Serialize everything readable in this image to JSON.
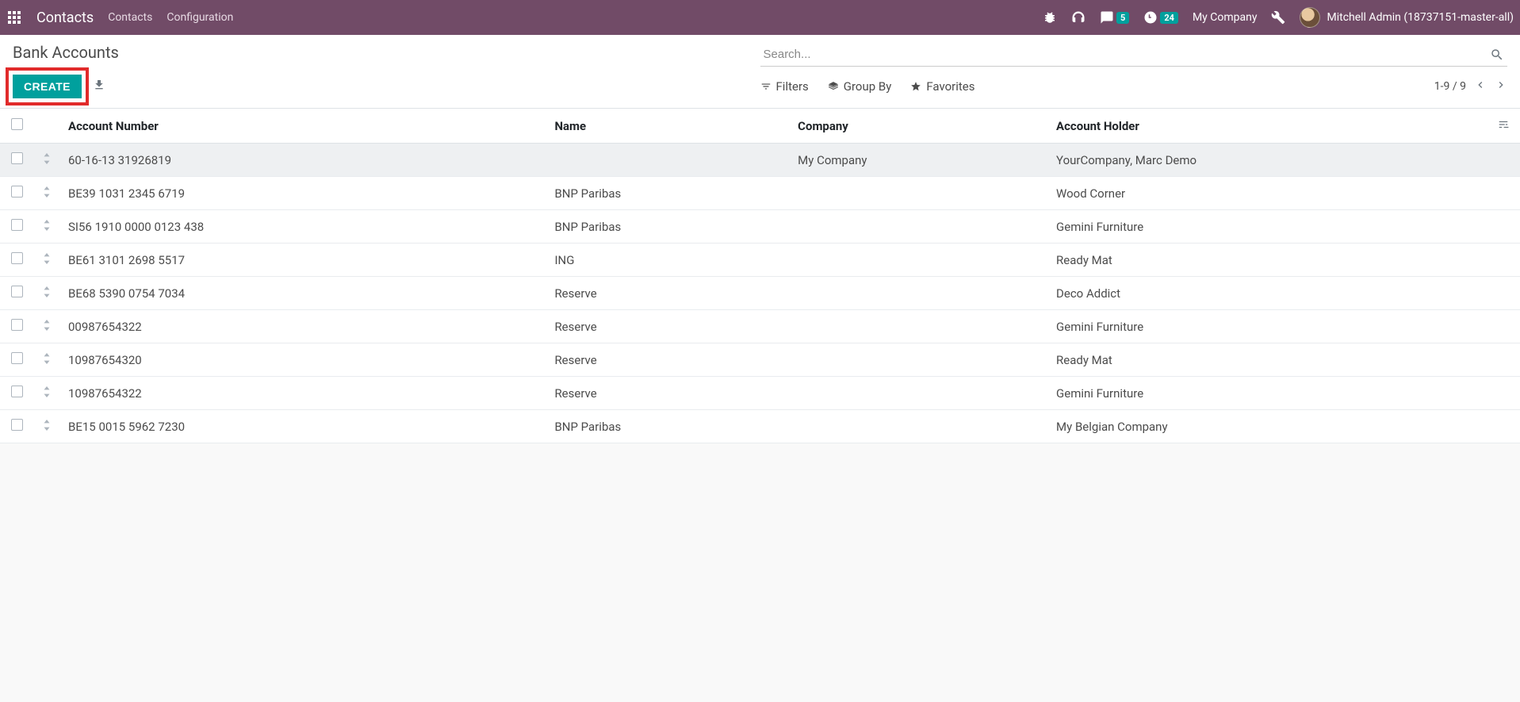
{
  "navbar": {
    "brand": "Contacts",
    "links": [
      "Contacts",
      "Configuration"
    ],
    "messages_badge": "5",
    "activities_badge": "24",
    "company": "My Company",
    "user": "Mitchell Admin (18737151-master-all)"
  },
  "controlPanel": {
    "title": "Bank Accounts",
    "createLabel": "CREATE",
    "searchPlaceholder": "Search...",
    "filters": "Filters",
    "groupBy": "Group By",
    "favorites": "Favorites",
    "pager": "1-9 / 9"
  },
  "columns": {
    "account": "Account Number",
    "name": "Name",
    "company": "Company",
    "holder": "Account Holder"
  },
  "rows": [
    {
      "account": "60-16-13 31926819",
      "name": "",
      "company": "My Company",
      "holder": "YourCompany, Marc Demo"
    },
    {
      "account": "BE39 1031 2345 6719",
      "name": "BNP Paribas",
      "company": "",
      "holder": "Wood Corner"
    },
    {
      "account": "SI56 1910 0000 0123 438",
      "name": "BNP Paribas",
      "company": "",
      "holder": "Gemini Furniture"
    },
    {
      "account": "BE61 3101 2698 5517",
      "name": "ING",
      "company": "",
      "holder": "Ready Mat"
    },
    {
      "account": "BE68 5390 0754 7034",
      "name": "Reserve",
      "company": "",
      "holder": "Deco Addict"
    },
    {
      "account": "00987654322",
      "name": "Reserve",
      "company": "",
      "holder": "Gemini Furniture"
    },
    {
      "account": "10987654320",
      "name": "Reserve",
      "company": "",
      "holder": "Ready Mat"
    },
    {
      "account": "10987654322",
      "name": "Reserve",
      "company": "",
      "holder": "Gemini Furniture"
    },
    {
      "account": "BE15 0015 5962 7230",
      "name": "BNP Paribas",
      "company": "",
      "holder": "My Belgian Company"
    }
  ]
}
